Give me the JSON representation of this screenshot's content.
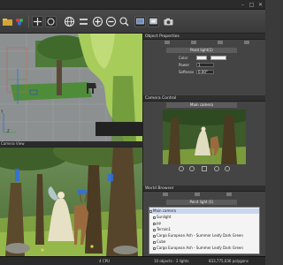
{
  "window": {
    "controls": [
      "–",
      "□",
      "✕"
    ]
  },
  "toolbar": {
    "icons": [
      "folder-open-icon",
      "color-palette-icon",
      "move-icon",
      "rotate-icon",
      "globe-icon",
      "align-icon",
      "add-icon",
      "remove-icon",
      "zoom-icon",
      "viewport-icon",
      "render-icon",
      "camera-icon"
    ]
  },
  "viewport_top": {
    "axis_label_left": "Y",
    "axis_label_bottom": "Z"
  },
  "viewport_bottom": {
    "title": "Camera View"
  },
  "object_properties": {
    "title": "Object Properties",
    "subhead": "Point light(1)",
    "rows": [
      {
        "label": "Color",
        "value": ""
      },
      {
        "label": "Power",
        "value": "1"
      },
      {
        "label": "Softness",
        "value": "0.00°"
      }
    ]
  },
  "camera_control": {
    "title": "Camera Control",
    "subhead": "Main camera"
  },
  "world_browser": {
    "title": "World Browser",
    "subhead": "Point light (1)",
    "items": [
      {
        "label": "Main camera",
        "selected": true
      },
      {
        "label": "Sunlight",
        "selected": false
      },
      {
        "label": "pp",
        "selected": false
      },
      {
        "label": "Terrain1",
        "selected": false
      },
      {
        "label": "Cargo European Ash - Summer Leafy Dark Green",
        "selected": false
      },
      {
        "label": "Cube",
        "selected": false
      },
      {
        "label": "Cargo European Ash - Summer Leafy Dark Green",
        "selected": false
      }
    ]
  },
  "status": {
    "fps": "4 CPU",
    "objects": "10 objects - 3 lights",
    "polygons": "833,775,036 polygons"
  }
}
